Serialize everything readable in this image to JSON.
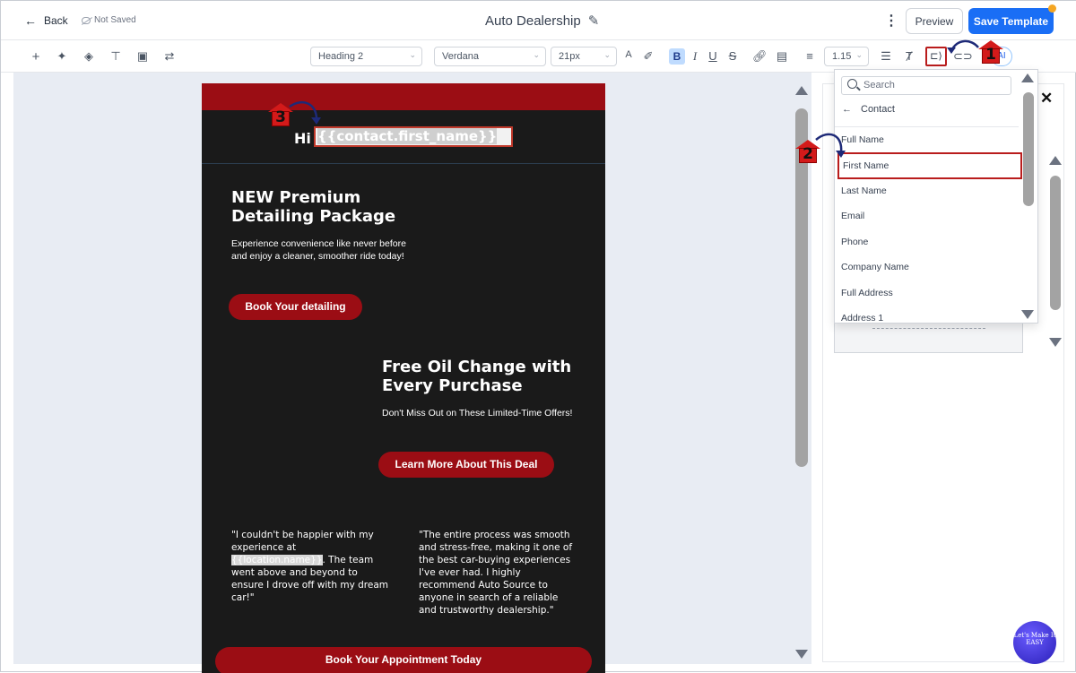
{
  "header": {
    "back_label": "Back",
    "status": "Not Saved",
    "title": "Auto Dealership",
    "preview_label": "Preview",
    "save_label": "Save Template"
  },
  "toolbar": {
    "block_style": "Heading 2",
    "font_family": "Verdana",
    "font_size": "21px",
    "line_height": "1.15",
    "ai_label": "AI"
  },
  "email": {
    "greeting": "Hi",
    "merge_field": "{{contact.first_name}}",
    "promo1": {
      "title": "NEW Premium Detailing Package",
      "text": "Experience convenience like never before and enjoy a cleaner, smoother ride today!",
      "button": "Book Your detailing"
    },
    "promo2": {
      "title": "Free Oil Change with Every Purchase",
      "text": "Don't Miss Out on These Limited-Time Offers!",
      "button": "Learn More About This Deal"
    },
    "testimonial1": {
      "before": "\"I couldn't be happier with my experience at ",
      "token": "{{location.name}}",
      "after": ". The team went above and beyond to ensure I drove off with my dream car!\""
    },
    "testimonial2": "\"The entire process was smooth and stress-free, making it one of the best car-buying experiences I've ever had. I highly recommend Auto Source to anyone in search of a reliable and trustworthy dealership.\"",
    "cta_button": "Book Your Appointment Today"
  },
  "dropdown": {
    "search_placeholder": "Search",
    "back_label": "Contact",
    "items": [
      "Full Name",
      "First Name",
      "Last Name",
      "Email",
      "Phone",
      "Company Name",
      "Full Address",
      "Address 1"
    ],
    "selected": "First Name"
  },
  "annotations": {
    "step1": "1",
    "step2": "2",
    "step3": "3",
    "marker_color": "#d31a1a",
    "arrow_color": "#1e2a78"
  },
  "logo_text": "Let's Make It EASY",
  "colors": {
    "accent": "#1a6ef5",
    "email_bg": "#1a1a1a",
    "email_red": "#9b0d14",
    "highlight": "#b91c1c"
  }
}
